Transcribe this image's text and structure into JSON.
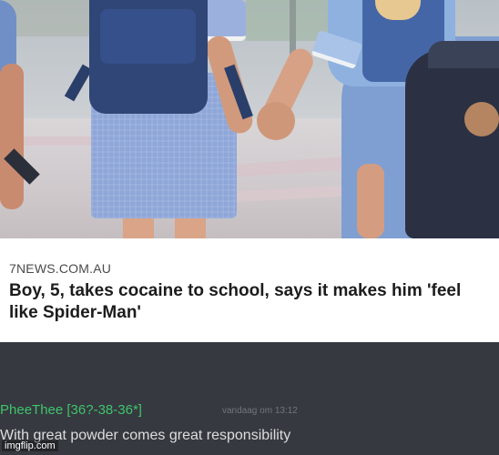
{
  "article": {
    "source": "7NEWS.COM.AU",
    "headline": "Boy, 5, takes cocaine to school, says it makes him 'feel like Spider-Man'"
  },
  "comment": {
    "username": "PheeThee [36?-38-36*]",
    "timestamp": "vandaag om 13:12",
    "message": "With great powder comes great responsibility"
  },
  "watermark": "imgflip.com",
  "colors": {
    "username": "#3ec46d",
    "discord_bg": "#36393f",
    "card_bg": "#ffffff"
  }
}
